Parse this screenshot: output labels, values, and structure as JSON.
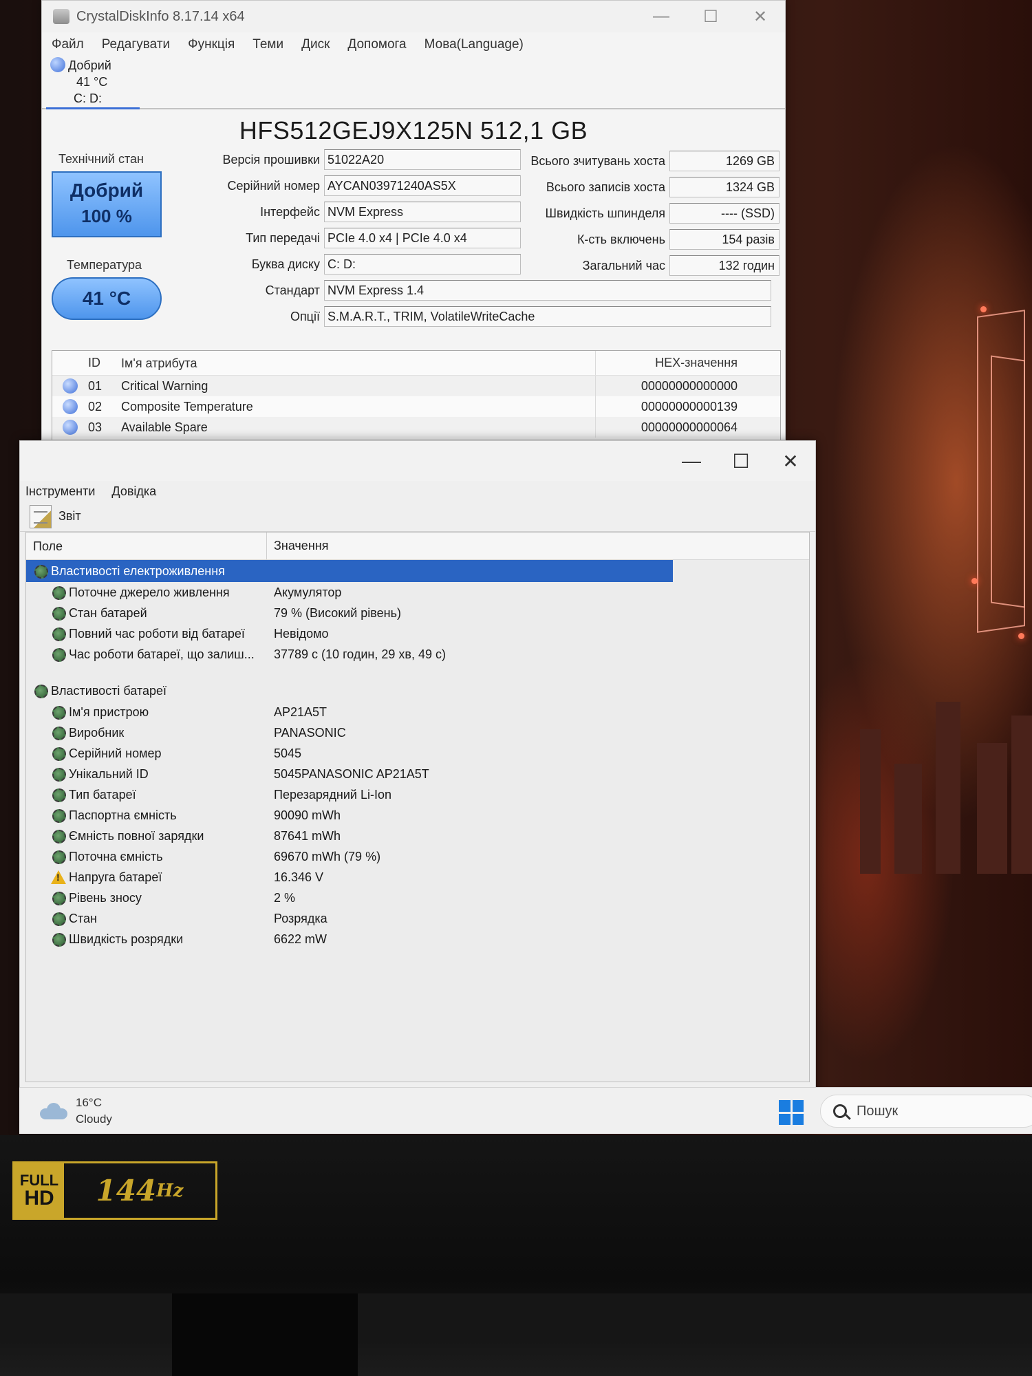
{
  "crystaldisk": {
    "title": "CrystalDiskInfo 8.17.14 x64",
    "menu": [
      "Файл",
      "Редагувати",
      "Функція",
      "Теми",
      "Диск",
      "Допомога",
      "Мова(Language)"
    ],
    "drive_tab": {
      "status": "Добрий",
      "temp": "41 °C",
      "letters": "C: D:"
    },
    "model": "HFS512GEJ9X125N 512,1 GB",
    "health_label": "Технічний стан",
    "health_status": "Добрий",
    "health_percent": "100 %",
    "temperature_label": "Температура",
    "temperature_value": "41 °C",
    "fields": {
      "firmware": {
        "label": "Версія прошивки",
        "value": "51022A20"
      },
      "serial": {
        "label": "Серійний номер",
        "value": "AYCAN03971240AS5X"
      },
      "interface": {
        "label": "Інтерфейс",
        "value": "NVM Express"
      },
      "transfer": {
        "label": "Тип передачі",
        "value": "PCIe 4.0 x4 | PCIe 4.0 x4"
      },
      "drive_letter": {
        "label": "Буква диску",
        "value": "C: D:"
      },
      "standard": {
        "label": "Стандарт",
        "value": "NVM Express 1.4"
      },
      "features": {
        "label": "Опції",
        "value": "S.M.A.R.T., TRIM, VolatileWriteCache"
      }
    },
    "right_fields": {
      "host_reads": {
        "label": "Всього зчитувань хоста",
        "value": "1269 GB"
      },
      "host_writes": {
        "label": "Всього записів хоста",
        "value": "1324 GB"
      },
      "rotation": {
        "label": "Швидкість шпинделя",
        "value": "---- (SSD)"
      },
      "power_count": {
        "label": "К-сть включень",
        "value": "154 разів"
      },
      "power_hours": {
        "label": "Загальний час",
        "value": "132 годин"
      }
    },
    "smart": {
      "headers": {
        "id": "ID",
        "name": "Ім'я атрибута",
        "hex": "HEX-значення"
      },
      "rows": [
        {
          "id": "01",
          "name": "Critical Warning",
          "hex": "00000000000000"
        },
        {
          "id": "02",
          "name": "Composite Temperature",
          "hex": "00000000000139"
        },
        {
          "id": "03",
          "name": "Available Spare",
          "hex": "00000000000064"
        }
      ]
    }
  },
  "battery_window": {
    "menu": [
      "Інструменти",
      "Довідка"
    ],
    "toolbar_report": "Звіт",
    "headers": {
      "field": "Поле",
      "value": "Значення"
    },
    "power_section": "Властивості електроживлення",
    "power_rows": [
      {
        "field": "Поточне джерело живлення",
        "value": "Акумулятор"
      },
      {
        "field": "Стан батарей",
        "value": "79 % (Високий рівень)"
      },
      {
        "field": "Повний час роботи від батареї",
        "value": "Невідомо"
      },
      {
        "field": "Час роботи батареї, що залиш...",
        "value": "37789 с (10 годин, 29 хв, 49 с)"
      }
    ],
    "battery_section": "Властивості батареї",
    "battery_rows": [
      {
        "field": "Ім'я пристрою",
        "value": "AP21A5T",
        "icon": "gear-icon"
      },
      {
        "field": "Виробник",
        "value": "PANASONIC",
        "icon": "gear-icon"
      },
      {
        "field": "Серійний номер",
        "value": "5045",
        "icon": "gear-icon"
      },
      {
        "field": "Унікальний ID",
        "value": "5045PANASONIC AP21A5T",
        "icon": "gear-icon"
      },
      {
        "field": "Тип батареї",
        "value": "Перезарядний Li-Ion",
        "icon": "gear-icon"
      },
      {
        "field": "Паспортна ємність",
        "value": "90090 mWh",
        "icon": "gear-icon"
      },
      {
        "field": "Ємність повної зарядки",
        "value": "87641 mWh",
        "icon": "gear-icon"
      },
      {
        "field": "Поточна ємність",
        "value": "69670 mWh  (79 %)",
        "icon": "gear-icon"
      },
      {
        "field": "Напруга батареї",
        "value": "16.346 V",
        "icon": "warning-icon"
      },
      {
        "field": "Рівень зносу",
        "value": "2 %",
        "icon": "gear-icon"
      },
      {
        "field": "Стан",
        "value": "Розрядка",
        "icon": "gear-icon"
      },
      {
        "field": "Швидкість розрядки",
        "value": "6622 mW",
        "icon": "gear-icon"
      }
    ]
  },
  "taskbar": {
    "weather_temp": "16°C",
    "weather_desc": "Cloudy",
    "search_placeholder": "Пошук"
  },
  "bezel": {
    "badge_fhd_1": "FULL",
    "badge_fhd_2": "HD",
    "badge_hz_num": "144",
    "badge_hz_unit": "Hz"
  }
}
